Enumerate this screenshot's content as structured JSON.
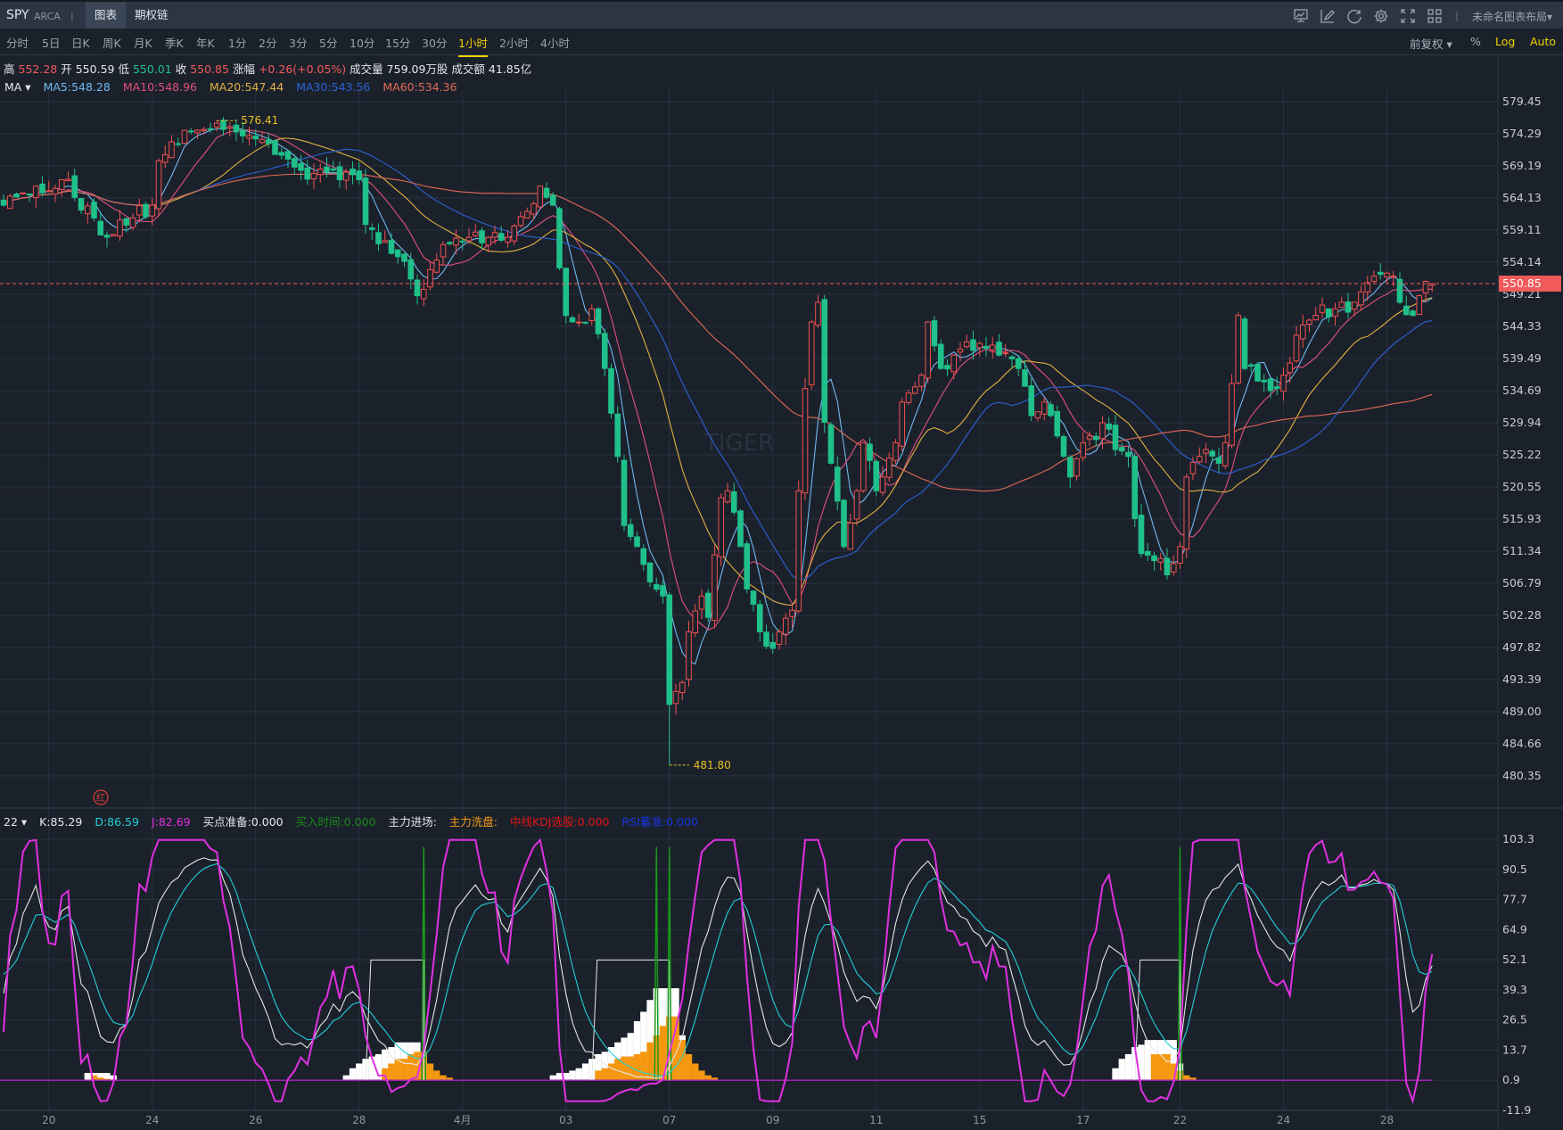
{
  "header": {
    "symbol": "SPY",
    "exchange": "ARCA",
    "separator": "|",
    "tabs": [
      "图表",
      "期权链"
    ],
    "layout_name": "未命名图表布局▾",
    "icons": [
      "chart-monitor-icon",
      "draw-pencil-icon",
      "refresh-icon",
      "settings-gear-icon",
      "fullscreen-icon",
      "grid-layout-icon"
    ]
  },
  "timeframes": [
    "分时",
    "5日",
    "日K",
    "周K",
    "月K",
    "季K",
    "年K",
    "1分",
    "2分",
    "3分",
    "5分",
    "10分",
    "15分",
    "30分",
    "1小时",
    "2小时",
    "4小时"
  ],
  "active_timeframe": "1小时",
  "options": {
    "adjust": "前复权 ▾",
    "percent": "%",
    "log": "Log",
    "auto": "Auto"
  },
  "quote": {
    "high_label": "高",
    "high": "552.28",
    "open_label": "开",
    "open": "550.59",
    "low_label": "低",
    "low": "550.01",
    "close_label": "收",
    "close": "550.85",
    "change_label": "涨幅",
    "change": "+0.26(+0.05%)",
    "volume_label": "成交量",
    "volume": "759.09万股",
    "amount_label": "成交额",
    "amount": "41.85亿"
  },
  "ma": {
    "label": "MA ▾",
    "ma5": "MA5:548.28",
    "ma10": "MA10:548.96",
    "ma20": "MA20:547.44",
    "ma30": "MA30:543.56",
    "ma60": "MA60:534.36"
  },
  "indicator": {
    "period": "22 ▾",
    "k": "K:85.29",
    "d": "D:86.59",
    "j": "J:82.69",
    "buy_ready": "买点准备:0.000",
    "buy_time": "买入时间:0.000",
    "main_entry": "主力进场:",
    "main_wash": "主力洗盘:",
    "mid_kdj": "中线KDJ选股:0.000",
    "rsi": "RSI蓄准:0.000"
  },
  "marker_label": "红",
  "colors": {
    "up": "#f05050",
    "down": "#1fc08a",
    "ma5": "#6fb8f0",
    "ma10": "#e0507a",
    "ma20": "#e0b040",
    "ma30": "#2a62d6",
    "ma60": "#e06a55",
    "k": "#e6e6e6",
    "d": "#22cfd6",
    "j": "#e030e0",
    "accent": "#f0d200"
  },
  "chart_data": {
    "type": "candlestick",
    "bar_count": 222,
    "price_axis_labels": [
      "579.45",
      "574.29",
      "569.19",
      "564.13",
      "559.11",
      "554.14",
      "549.21",
      "544.33",
      "539.49",
      "534.69",
      "529.94",
      "525.22",
      "520.55",
      "515.93",
      "511.34",
      "506.79",
      "502.28",
      "497.82",
      "493.39",
      "489.00",
      "484.66",
      "480.35"
    ],
    "price_range": [
      480.35,
      579.45
    ],
    "current_price": "550.85",
    "high_mark": {
      "bar": 33,
      "price": 576.41,
      "label": "576.41"
    },
    "low_mark": {
      "bar": 103,
      "price": 481.8,
      "label": "481.80"
    },
    "date_labels": [
      {
        "bar": 7,
        "label": "20"
      },
      {
        "bar": 23,
        "label": "24"
      },
      {
        "bar": 39,
        "label": "26"
      },
      {
        "bar": 55,
        "label": "28"
      },
      {
        "bar": 71,
        "label": "4月"
      },
      {
        "bar": 87,
        "label": "03"
      },
      {
        "bar": 103,
        "label": "07"
      },
      {
        "bar": 119,
        "label": "09"
      },
      {
        "bar": 135,
        "label": "11"
      },
      {
        "bar": 151,
        "label": "15"
      },
      {
        "bar": 167,
        "label": "17"
      },
      {
        "bar": 182,
        "label": "22"
      },
      {
        "bar": 198,
        "label": "24"
      },
      {
        "bar": 214,
        "label": "28"
      }
    ],
    "price_keypoints": [
      [
        0,
        563
      ],
      [
        5,
        566
      ],
      [
        9,
        567
      ],
      [
        14,
        561
      ],
      [
        16,
        558
      ],
      [
        20,
        561
      ],
      [
        23,
        563
      ],
      [
        24,
        570
      ],
      [
        26,
        573
      ],
      [
        31,
        575
      ],
      [
        33,
        576
      ],
      [
        38,
        574
      ],
      [
        42,
        571
      ],
      [
        45,
        569
      ],
      [
        48,
        568
      ],
      [
        52,
        567
      ],
      [
        55,
        567
      ],
      [
        56,
        560
      ],
      [
        58,
        557
      ],
      [
        61,
        555
      ],
      [
        64,
        549
      ],
      [
        66,
        553
      ],
      [
        69,
        557
      ],
      [
        72,
        558
      ],
      [
        75,
        558
      ],
      [
        78,
        558
      ],
      [
        81,
        562
      ],
      [
        83,
        566
      ],
      [
        85,
        563
      ],
      [
        87,
        546
      ],
      [
        89,
        545
      ],
      [
        91,
        547
      ],
      [
        93,
        538
      ],
      [
        95,
        525
      ],
      [
        96,
        515
      ],
      [
        98,
        512
      ],
      [
        100,
        507
      ],
      [
        102,
        505
      ],
      [
        103,
        490
      ],
      [
        105,
        493
      ],
      [
        106,
        500
      ],
      [
        108,
        505
      ],
      [
        109,
        502
      ],
      [
        111,
        519
      ],
      [
        112,
        520
      ],
      [
        114,
        512
      ],
      [
        115,
        506
      ],
      [
        117,
        500
      ],
      [
        118,
        498
      ],
      [
        120,
        500
      ],
      [
        122,
        503
      ],
      [
        123,
        520
      ],
      [
        124,
        535
      ],
      [
        125,
        545
      ],
      [
        126,
        548
      ],
      [
        127,
        530
      ],
      [
        128,
        524
      ],
      [
        130,
        512
      ],
      [
        132,
        520
      ],
      [
        133,
        527
      ],
      [
        135,
        520
      ],
      [
        136,
        522
      ],
      [
        138,
        527
      ],
      [
        139,
        533
      ],
      [
        142,
        537
      ],
      [
        143,
        545
      ],
      [
        145,
        538
      ],
      [
        147,
        540
      ],
      [
        149,
        542
      ],
      [
        152,
        541
      ],
      [
        154,
        540
      ],
      [
        157,
        538
      ],
      [
        159,
        531
      ],
      [
        161,
        533
      ],
      [
        162,
        531
      ],
      [
        163,
        528
      ],
      [
        165,
        522
      ],
      [
        167,
        527
      ],
      [
        168,
        528
      ],
      [
        171,
        529
      ],
      [
        172,
        526
      ],
      [
        174,
        525
      ],
      [
        175,
        516
      ],
      [
        176,
        511
      ],
      [
        178,
        510
      ],
      [
        180,
        508
      ],
      [
        182,
        512
      ],
      [
        183,
        522
      ],
      [
        185,
        525
      ],
      [
        186,
        526
      ],
      [
        188,
        524
      ],
      [
        189,
        527
      ],
      [
        191,
        546
      ],
      [
        192,
        538
      ],
      [
        195,
        536
      ],
      [
        197,
        535
      ],
      [
        198,
        537
      ],
      [
        200,
        543
      ],
      [
        203,
        546
      ],
      [
        206,
        547
      ],
      [
        209,
        548
      ],
      [
        211,
        551
      ],
      [
        212,
        552
      ],
      [
        215,
        552
      ],
      [
        216,
        548
      ],
      [
        218,
        546
      ],
      [
        219,
        549
      ],
      [
        221,
        550.85
      ]
    ],
    "ma_periods": [
      5,
      10,
      20,
      30,
      60
    ],
    "kdj_axis_labels": [
      "103.3",
      "90.5",
      "77.7",
      "64.9",
      "52.1",
      "39.3",
      "26.5",
      "13.7",
      "0.9",
      "-11.9"
    ],
    "kdj_range": [
      -11.9,
      103.3
    ],
    "white_hist": [
      [
        13,
        4
      ],
      [
        14,
        4
      ],
      [
        15,
        4
      ],
      [
        16,
        4
      ],
      [
        17,
        3
      ],
      [
        53,
        3
      ],
      [
        54,
        6
      ],
      [
        55,
        8
      ],
      [
        56,
        10
      ],
      [
        57,
        11
      ],
      [
        58,
        12
      ],
      [
        59,
        14
      ],
      [
        60,
        15
      ],
      [
        61,
        17
      ],
      [
        62,
        17
      ],
      [
        63,
        17
      ],
      [
        64,
        17
      ],
      [
        65,
        10
      ],
      [
        85,
        3
      ],
      [
        86,
        4
      ],
      [
        87,
        4
      ],
      [
        88,
        5
      ],
      [
        89,
        6
      ],
      [
        90,
        8
      ],
      [
        91,
        10
      ],
      [
        92,
        12
      ],
      [
        93,
        13
      ],
      [
        94,
        15
      ],
      [
        95,
        17
      ],
      [
        96,
        19
      ],
      [
        97,
        21
      ],
      [
        98,
        26
      ],
      [
        99,
        30
      ],
      [
        100,
        35
      ],
      [
        101,
        40
      ],
      [
        102,
        40
      ],
      [
        103,
        40
      ],
      [
        104,
        40
      ],
      [
        105,
        20
      ],
      [
        172,
        6
      ],
      [
        173,
        10
      ],
      [
        174,
        12
      ],
      [
        175,
        15
      ],
      [
        176,
        16
      ],
      [
        177,
        18
      ],
      [
        178,
        18
      ],
      [
        179,
        18
      ],
      [
        180,
        18
      ],
      [
        181,
        18
      ],
      [
        182,
        8
      ]
    ],
    "orange_hist": [
      [
        14,
        3
      ],
      [
        15,
        2
      ],
      [
        16,
        1.5
      ],
      [
        17,
        1.2
      ],
      [
        59,
        6
      ],
      [
        60,
        8
      ],
      [
        61,
        10
      ],
      [
        62,
        10
      ],
      [
        63,
        12
      ],
      [
        64,
        13
      ],
      [
        65,
        13
      ],
      [
        66,
        8
      ],
      [
        67,
        5
      ],
      [
        68,
        3
      ],
      [
        69,
        2
      ],
      [
        92,
        5
      ],
      [
        93,
        6
      ],
      [
        94,
        8
      ],
      [
        95,
        10
      ],
      [
        96,
        11
      ],
      [
        97,
        11
      ],
      [
        98,
        12
      ],
      [
        99,
        13
      ],
      [
        100,
        17
      ],
      [
        101,
        20
      ],
      [
        102,
        24
      ],
      [
        103,
        28
      ],
      [
        104,
        28
      ],
      [
        105,
        18
      ],
      [
        106,
        12
      ],
      [
        107,
        8
      ],
      [
        108,
        5
      ],
      [
        109,
        3
      ],
      [
        110,
        2
      ],
      [
        178,
        12
      ],
      [
        179,
        12
      ],
      [
        180,
        12
      ],
      [
        181,
        8
      ],
      [
        182,
        5
      ],
      [
        183,
        3
      ],
      [
        184,
        2
      ]
    ],
    "green_spikes": [
      65,
      101,
      103,
      182
    ],
    "buy_ready_steps": [
      {
        "from": 56,
        "to": 65,
        "level": 52
      },
      {
        "from": 91,
        "to": 103,
        "level": 52
      },
      {
        "from": 175,
        "to": 182,
        "level": 52
      }
    ]
  }
}
